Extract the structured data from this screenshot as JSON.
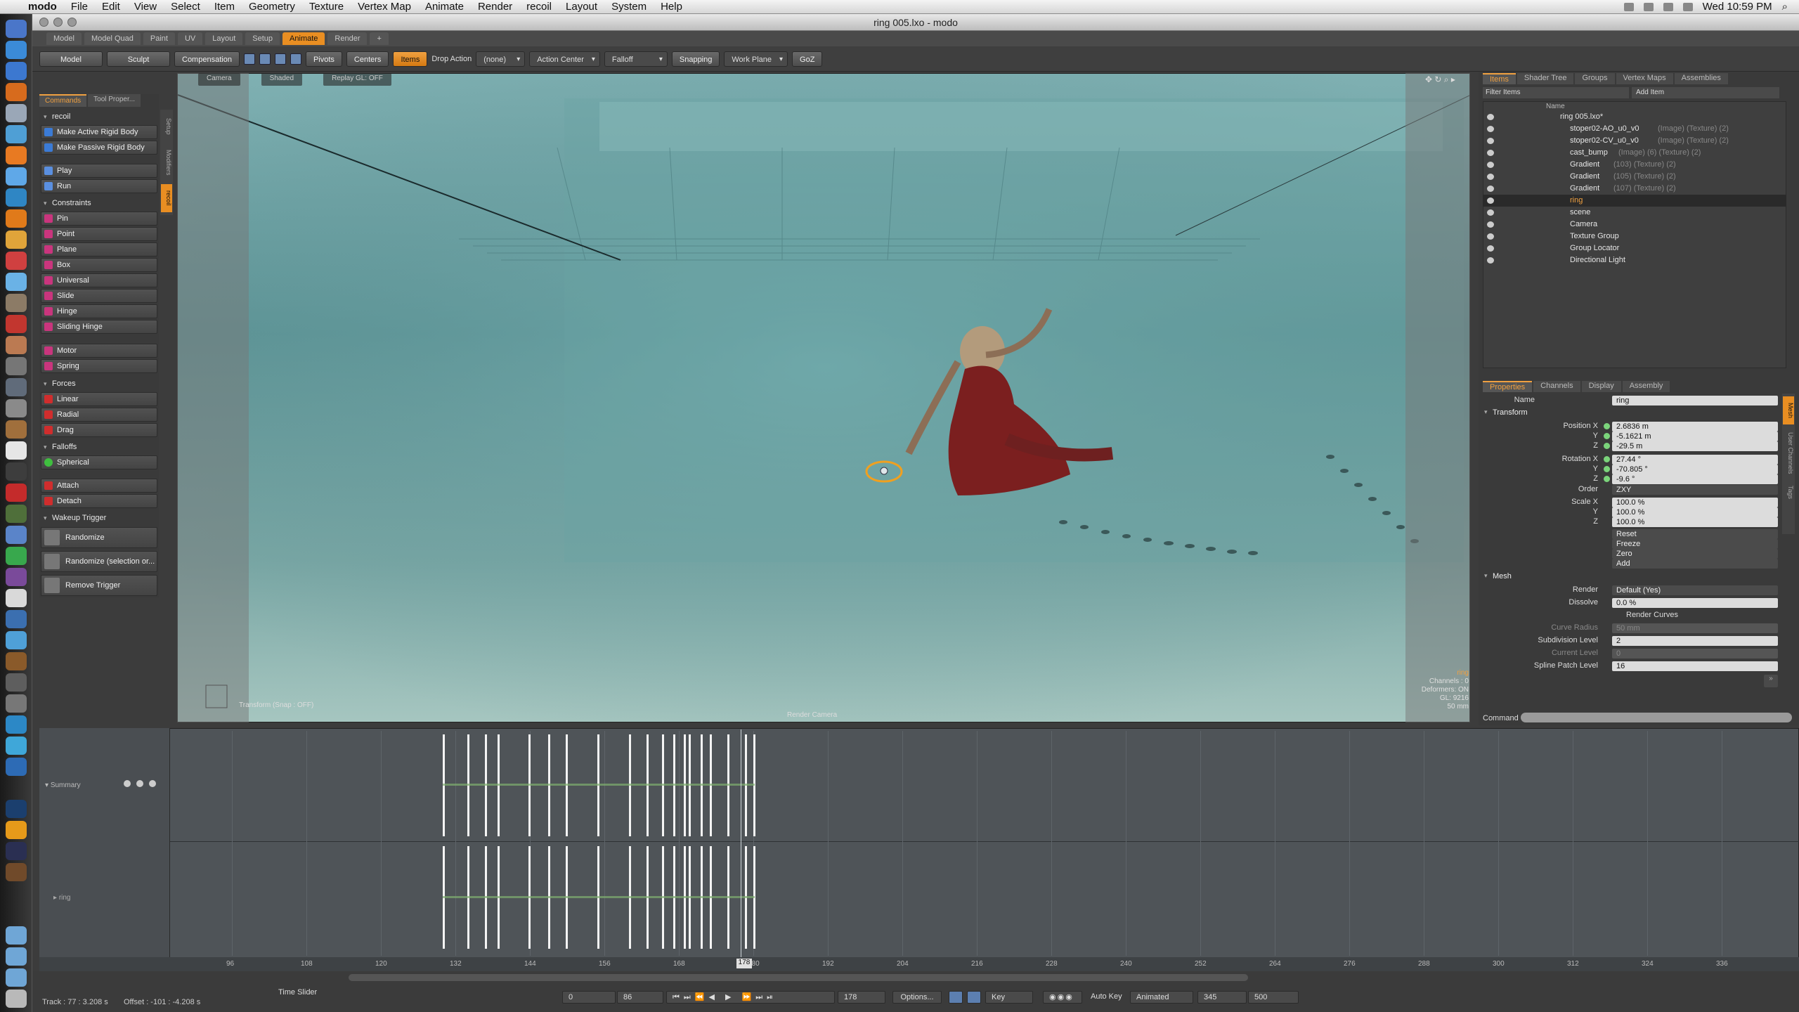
{
  "menubar": {
    "app_name": "modo",
    "items": [
      "File",
      "Edit",
      "View",
      "Select",
      "Item",
      "Geometry",
      "Texture",
      "Vertex Map",
      "Animate",
      "Render",
      "recoil",
      "Layout",
      "System",
      "Help"
    ],
    "clock": "Wed 10:59 PM"
  },
  "window": {
    "title": "ring 005.lxo - modo"
  },
  "layout_tabs": [
    "Model",
    "Model Quad",
    "Paint",
    "UV",
    "Layout",
    "Setup",
    "Animate",
    "Render"
  ],
  "layout_tab_active": "Animate",
  "toolbar": {
    "model": "Model",
    "sculpt": "Sculpt",
    "compensation": "Compensation",
    "pivots": "Pivots",
    "centers": "Centers",
    "items": "Items",
    "drop_action_label": "Drop Action",
    "drop_action_value": "(none)",
    "action_center": "Action Center",
    "falloff": "Falloff",
    "snapping": "Snapping",
    "work_plane": "Work Plane",
    "goz": "GoZ"
  },
  "left_panel": {
    "tabs": [
      "Commands",
      "Tool Proper..."
    ],
    "active_tab": "Commands",
    "group_title": "recoil",
    "make_active": "Make Active Rigid Body",
    "make_passive": "Make Passive Rigid Body",
    "play": "Play",
    "run": "Run",
    "constraints_title": "Constraints",
    "constraints": [
      "Pin",
      "Point",
      "Plane",
      "Box",
      "Universal",
      "Slide",
      "Hinge",
      "Sliding Hinge"
    ],
    "motor": "Motor",
    "spring": "Spring",
    "forces_title": "Forces",
    "forces": [
      "Linear",
      "Radial",
      "Drag"
    ],
    "falloffs_title": "Falloffs",
    "spherical": "Spherical",
    "attach": "Attach",
    "detach": "Detach",
    "wakeup_title": "Wakeup Trigger",
    "randomize": "Randomize",
    "randomize_sel": "Randomize (selection or...",
    "remove_trigger": "Remove Trigger",
    "side_tabs": [
      "Setup",
      "Modifiers",
      "recoil"
    ]
  },
  "viewport": {
    "camera": "Camera",
    "shaded": "Shaded",
    "replay": "Replay GL: OFF",
    "transform_status": "Transform (Snap : OFF)",
    "render_camera": "Render Camera",
    "info_item": "ring",
    "info_channels": "Channels : 0",
    "info_deformers": "Deformers: ON",
    "info_gl": "GL: 9216",
    "info_lens": "50 mm"
  },
  "items_panel": {
    "tabs": [
      "Items",
      "Shader Tree",
      "Groups",
      "Vertex Maps",
      "Assemblies"
    ],
    "active_tab": "Items",
    "filter": "Filter Items",
    "add_item": "Add Item",
    "col_name": "Name",
    "rows": [
      {
        "name": "ring 005.lxo*",
        "extra": "",
        "indent": 0,
        "sel": false
      },
      {
        "name": "stoper02-AO_u0_v0",
        "extra": "(Image) (Texture) (2)",
        "indent": 1,
        "sel": false
      },
      {
        "name": "stoper02-CV_u0_v0",
        "extra": "(Image) (Texture) (2)",
        "indent": 1,
        "sel": false
      },
      {
        "name": "cast_bump",
        "extra": "(Image) (6) (Texture) (2)",
        "indent": 1,
        "sel": false
      },
      {
        "name": "Gradient",
        "extra": "(103) (Texture) (2)",
        "indent": 1,
        "sel": false
      },
      {
        "name": "Gradient",
        "extra": "(105) (Texture) (2)",
        "indent": 1,
        "sel": false
      },
      {
        "name": "Gradient",
        "extra": "(107) (Texture) (2)",
        "indent": 1,
        "sel": false
      },
      {
        "name": "ring",
        "extra": "",
        "indent": 1,
        "sel": true
      },
      {
        "name": "scene",
        "extra": "",
        "indent": 1,
        "sel": false
      },
      {
        "name": "Camera",
        "extra": "",
        "indent": 1,
        "sel": false
      },
      {
        "name": "Texture Group",
        "extra": "",
        "indent": 1,
        "sel": false
      },
      {
        "name": "Group Locator",
        "extra": "",
        "indent": 1,
        "sel": false
      },
      {
        "name": "Directional Light",
        "extra": "",
        "indent": 1,
        "sel": false
      }
    ]
  },
  "properties": {
    "tabs": [
      "Properties",
      "Channels",
      "Display",
      "Assembly"
    ],
    "active_tab": "Properties",
    "name_label": "Name",
    "name_value": "ring",
    "transform_title": "Transform",
    "position_label": "Position X",
    "pos": [
      "2.6836 m",
      "-5.1621 m",
      "-29.5 m"
    ],
    "rotation_label": "Rotation X",
    "rot": [
      "27.44 °",
      "-70.805 °",
      "-9.6 °"
    ],
    "order_label": "Order",
    "order_value": "ZXY",
    "scale_label": "Scale X",
    "scale": [
      "100.0 %",
      "100.0 %",
      "100.0 %"
    ],
    "y_label": "Y",
    "z_label": "Z",
    "reset": "Reset",
    "freeze": "Freeze",
    "zero": "Zero",
    "add": "Add",
    "mesh_title": "Mesh",
    "render_label": "Render",
    "render_value": "Default (Yes)",
    "dissolve_label": "Dissolve",
    "dissolve_value": "0.0 %",
    "render_curves": "Render Curves",
    "curve_radius_label": "Curve Radius",
    "curve_radius_value": "50 mm",
    "subdiv_label": "Subdivision Level",
    "subdiv_value": "2",
    "current_level_label": "Current Level",
    "current_level_value": "0",
    "spline_label": "Spline Patch Level",
    "spline_value": "16",
    "command_label": "Command",
    "side_tabs": [
      "Mesh",
      "User Channels",
      "Tags"
    ]
  },
  "timeline": {
    "summary_label": "Summary",
    "ring_label": "ring",
    "ruler_ticks": [
      "96",
      "108",
      "120",
      "132",
      "144",
      "156",
      "168",
      "180",
      "192",
      "204",
      "216",
      "228",
      "240",
      "252",
      "264",
      "276",
      "288",
      "300",
      "312",
      "324",
      "336"
    ],
    "current_frame_marker": "178"
  },
  "bottom": {
    "track": "Track : 77 : 3.208 s",
    "offset": "Offset : -101 : -4.208 s",
    "time_slider": "Time Slider",
    "start": "0",
    "end": "86",
    "current": "178",
    "options": "Options...",
    "key": "Key",
    "auto_key": "Auto Key",
    "animated": "Animated",
    "range_start": "345",
    "range_end": "500"
  },
  "colors": {
    "accent": "#e98e22",
    "viewport_water": "#5f8f93",
    "dress": "#7b1f1f"
  }
}
